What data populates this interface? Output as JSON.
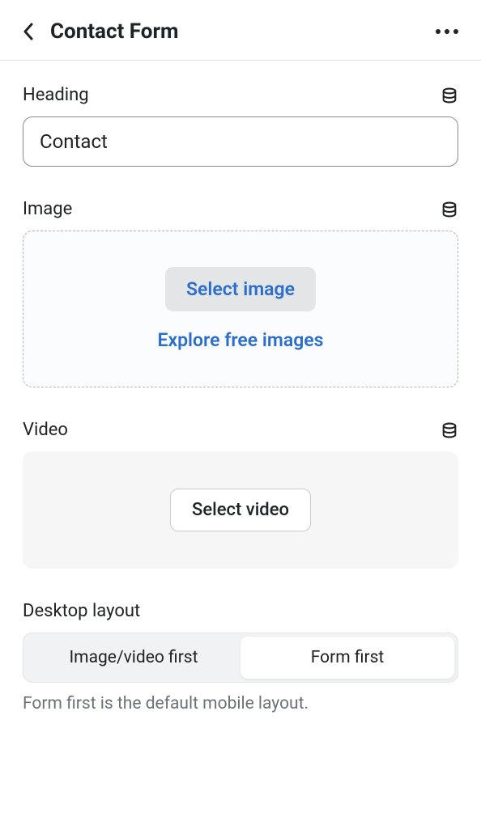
{
  "header": {
    "title": "Contact Form"
  },
  "heading": {
    "label": "Heading",
    "value": "Contact"
  },
  "image": {
    "label": "Image",
    "select_btn": "Select image",
    "explore_link": "Explore free images"
  },
  "video": {
    "label": "Video",
    "select_btn": "Select video"
  },
  "layout": {
    "label": "Desktop layout",
    "option1": "Image/video first",
    "option2": "Form first",
    "helper": "Form first is the default mobile layout."
  }
}
